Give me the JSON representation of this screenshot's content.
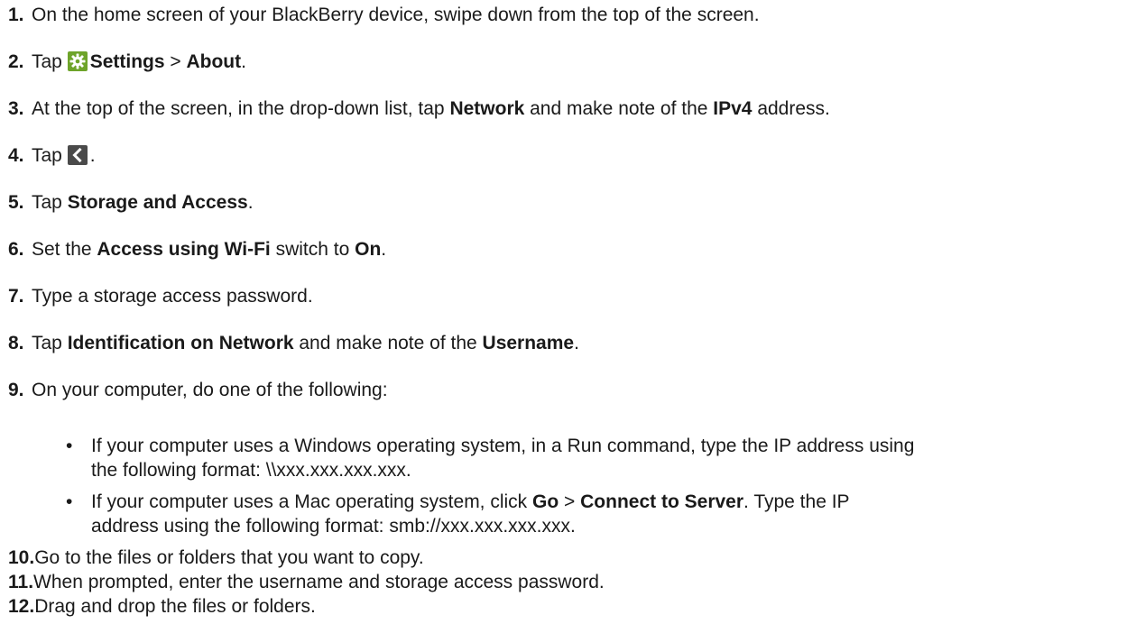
{
  "steps": [
    {
      "num": "1.",
      "text": "On the home screen of your BlackBerry device, swipe down from the top of the screen."
    },
    {
      "num": "2.",
      "pre": "Tap ",
      "b1": "Settings",
      "mid": " > ",
      "b2": "About",
      "post": "."
    },
    {
      "num": "3.",
      "pre": "At the top of the screen, in the drop-down list, tap ",
      "b1": "Network",
      "mid": " and make note of the ",
      "b2": "IPv4",
      "post": " address."
    },
    {
      "num": "4.",
      "pre": "Tap ",
      "post": "."
    },
    {
      "num": "5.",
      "pre": "Tap ",
      "b1": "Storage and Access",
      "post": "."
    },
    {
      "num": "6.",
      "pre": "Set the ",
      "b1": "Access using Wi-Fi",
      "mid": " switch to ",
      "b2": "On",
      "post": "."
    },
    {
      "num": "7.",
      "text": "Type a storage access password."
    },
    {
      "num": "8.",
      "pre": "Tap ",
      "b1": "Identification on Network",
      "mid": " and make note of the ",
      "b2": "Username",
      "post": "."
    },
    {
      "num": "9.",
      "text": "On your computer, do one of the following:"
    },
    {
      "num": "10.",
      "text": "Go to the files or folders that you want to copy."
    },
    {
      "num": "11.",
      "text": "When prompted, enter the username and storage access password."
    },
    {
      "num": "12.",
      "text": "Drag and drop the files or folders."
    }
  ],
  "sub_items": [
    {
      "bullet": "•",
      "line1": "If your computer uses a Windows operating system, in a Run command, type the IP address using",
      "line2": "the following format: \\\\xxx.xxx.xxx.xxx."
    },
    {
      "bullet": "•",
      "pre": "If your computer uses a Mac operating system, click ",
      "b1": "Go",
      "mid": " > ",
      "b2": "Connect to Server",
      "post": ". Type the IP",
      "line2": "address using the following format: smb://xxx.xxx.xxx.xxx."
    }
  ],
  "icons": {
    "settings": "gear-icon",
    "back": "back-chevron-icon"
  },
  "colors": {
    "text": "#1a1a1a",
    "gear_bg": "#6ea42a",
    "back_bg": "#4a4a4a"
  }
}
